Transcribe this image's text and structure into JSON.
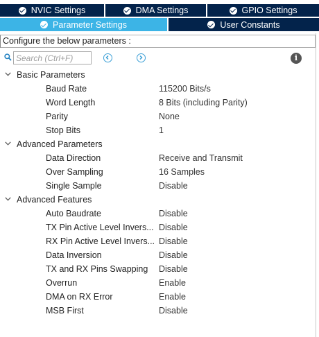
{
  "tabs_top": [
    {
      "label": "NVIC Settings"
    },
    {
      "label": "DMA Settings"
    },
    {
      "label": "GPIO Settings"
    }
  ],
  "tabs_bottom": [
    {
      "label": "Parameter Settings",
      "active": true
    },
    {
      "label": "User Constants",
      "active": false
    }
  ],
  "config_label": "Configure the below parameters :",
  "search": {
    "placeholder": "Search (Ctrl+F)"
  },
  "icons": {
    "search": "search-icon",
    "prev": "arrow-left-circle-icon",
    "next": "arrow-right-circle-icon",
    "info": "info-icon",
    "tab_check": "check-circle-icon",
    "expand": "chevron-down-icon"
  },
  "colors": {
    "tab_dark": "#03234b",
    "tab_active": "#3cb4e6",
    "nav_blue": "#3a9fd6"
  },
  "groups": [
    {
      "label": "Basic Parameters",
      "params": [
        {
          "name": "Baud Rate",
          "value": "115200 Bits/s"
        },
        {
          "name": "Word Length",
          "value": "8 Bits (including Parity)"
        },
        {
          "name": "Parity",
          "value": "None"
        },
        {
          "name": "Stop Bits",
          "value": "1"
        }
      ]
    },
    {
      "label": "Advanced Parameters",
      "params": [
        {
          "name": "Data Direction",
          "value": "Receive and Transmit"
        },
        {
          "name": "Over Sampling",
          "value": "16 Samples"
        },
        {
          "name": "Single Sample",
          "value": "Disable"
        }
      ]
    },
    {
      "label": "Advanced Features",
      "params": [
        {
          "name": "Auto Baudrate",
          "value": "Disable"
        },
        {
          "name": "TX Pin Active Level Invers...",
          "value": "Disable"
        },
        {
          "name": "RX Pin Active Level Invers...",
          "value": "Disable"
        },
        {
          "name": "Data Inversion",
          "value": "Disable"
        },
        {
          "name": "TX and RX Pins Swapping",
          "value": "Disable"
        },
        {
          "name": "Overrun",
          "value": "Enable"
        },
        {
          "name": "DMA on RX Error",
          "value": "Enable"
        },
        {
          "name": "MSB First",
          "value": "Disable"
        }
      ]
    }
  ]
}
